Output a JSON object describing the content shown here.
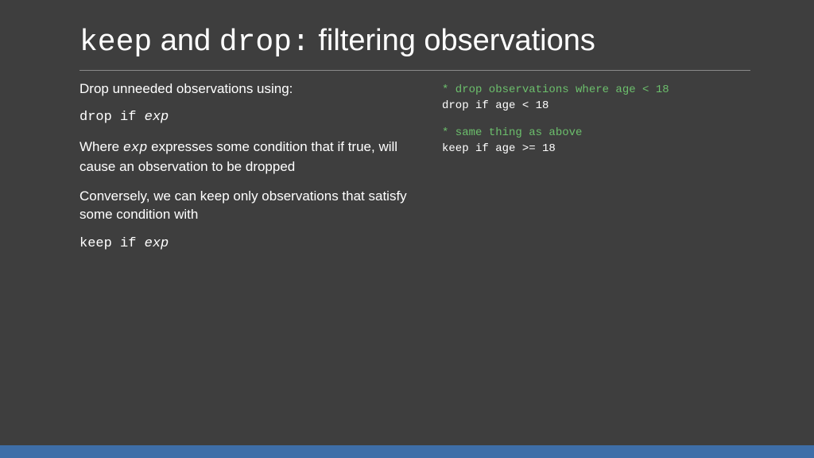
{
  "title": {
    "kw_keep": "keep",
    "sep1": " and ",
    "kw_drop": "drop:",
    "rest": " filtering observations"
  },
  "left": {
    "p1": "Drop unneeded observations using:",
    "p2_code_prefix": "drop if ",
    "p2_code_exp": "exp",
    "p3_a": "Where ",
    "p3_exp": "exp",
    "p3_b": " expresses some condition that if true, will cause an observation to be dropped",
    "p4": "Conversely, we can keep only observations that satisfy some condition with",
    "p5_code_prefix": "keep if ",
    "p5_code_exp": "exp"
  },
  "right": {
    "b1_comment": "* drop observations where age < 18",
    "b1_cmd": "drop if age < 18",
    "b2_comment": "* same thing as above",
    "b2_cmd": "keep if age >= 18"
  }
}
